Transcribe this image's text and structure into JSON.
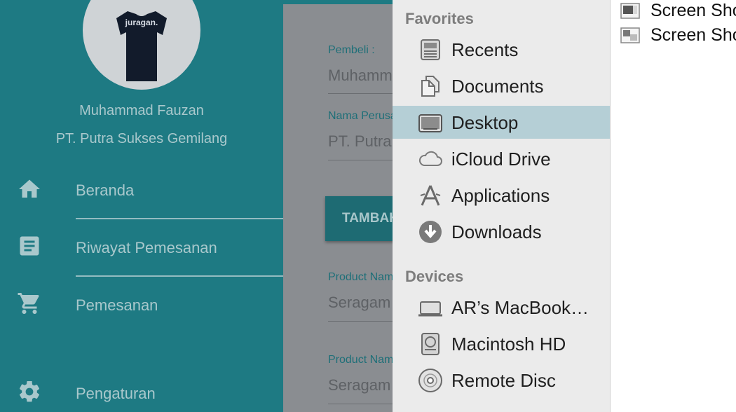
{
  "drawer": {
    "profile": {
      "name": "Muhammad Fauzan",
      "company": "PT. Putra Sukses Gemilang",
      "shirt_text": "juragan."
    },
    "items": [
      {
        "label": "Beranda",
        "icon": "home-icon"
      },
      {
        "label": "Riwayat Pemesanan",
        "icon": "document-icon"
      },
      {
        "label": "Pemesanan",
        "icon": "cart-icon"
      },
      {
        "label": "Pengaturan",
        "icon": "gear-icon"
      }
    ]
  },
  "form": {
    "buyer_label": "Pembeli :",
    "buyer_value": "Muhammad Fauzan",
    "company_label": "Nama Perusahaan",
    "company_value": "PT. Putra Sukses Gemilang",
    "button_label": "TAMBAH",
    "products": [
      {
        "label": "Product Name",
        "value": "Seragam"
      },
      {
        "label": "Product Name",
        "value": "Seragam"
      }
    ]
  },
  "finder": {
    "favorites_title": "Favorites",
    "favorites": [
      {
        "label": "Recents",
        "icon": "recents-icon"
      },
      {
        "label": "Documents",
        "icon": "documents-icon"
      },
      {
        "label": "Desktop",
        "icon": "desktop-icon",
        "selected": true
      },
      {
        "label": "iCloud Drive",
        "icon": "cloud-icon"
      },
      {
        "label": "Applications",
        "icon": "applications-icon"
      },
      {
        "label": "Downloads",
        "icon": "download-icon"
      }
    ],
    "devices_title": "Devices",
    "devices": [
      {
        "label": "AR’s MacBook…",
        "icon": "laptop-icon"
      },
      {
        "label": "Macintosh HD",
        "icon": "hard-drive-icon"
      },
      {
        "label": "Remote Disc",
        "icon": "disc-icon"
      }
    ]
  },
  "files": [
    {
      "name": "Screen Shot",
      "icon": "screenshot-file-icon"
    },
    {
      "name": "Screen Shot",
      "icon": "screenshot-file-icon"
    }
  ],
  "colors": {
    "drawer": "#1e7a83",
    "drawer_text": "#a9c8cc",
    "selection": "#b5cfd6",
    "finder_bg": "#ebebeb"
  }
}
